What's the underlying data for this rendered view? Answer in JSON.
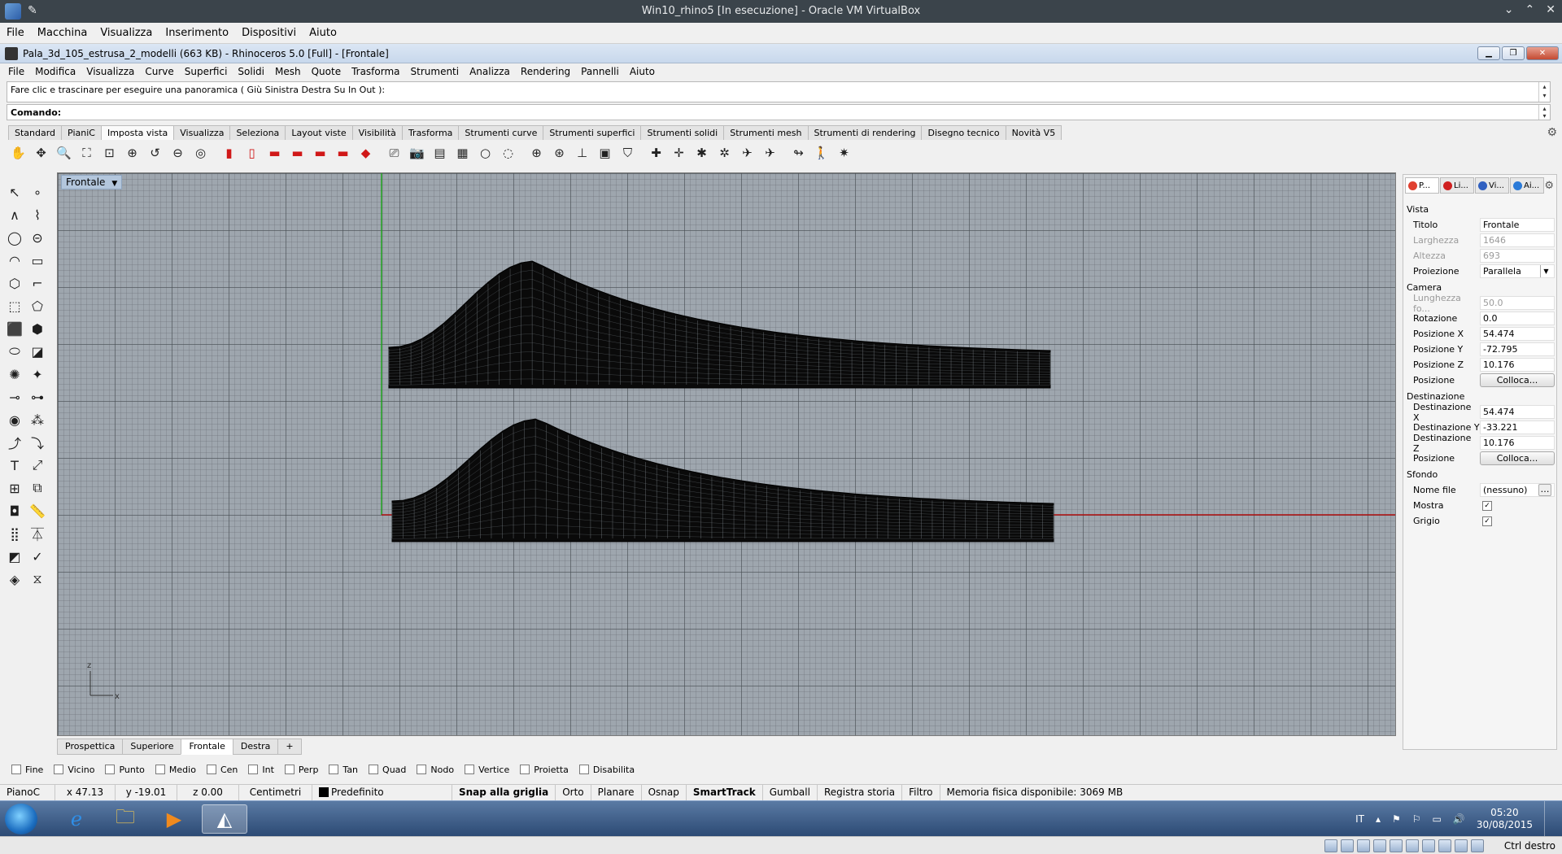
{
  "vbox": {
    "title": "Win10_rhino5 [In esecuzione] - Oracle VM VirtualBox",
    "menu": [
      "File",
      "Macchina",
      "Visualizza",
      "Inserimento",
      "Dispositivi",
      "Aiuto"
    ],
    "host_key": "Ctrl destro"
  },
  "rhino": {
    "title": "Pala_3d_105_estrusa_2_modelli (663 KB) - Rhinoceros 5.0 [Full] - [Frontale]",
    "menu": [
      "File",
      "Modifica",
      "Visualizza",
      "Curve",
      "Superfici",
      "Solidi",
      "Mesh",
      "Quote",
      "Trasforma",
      "Strumenti",
      "Analizza",
      "Rendering",
      "Pannelli",
      "Aiuto"
    ],
    "command_history": "Fare clic e trascinare per eseguire una panoramica ( Giù  Sinistra  Destra  Su  In  Out ):",
    "command_prompt": "Comando:",
    "toolbar_tabs": [
      {
        "label": "Standard",
        "active": false
      },
      {
        "label": "PianiC",
        "active": false
      },
      {
        "label": "Imposta vista",
        "active": true
      },
      {
        "label": "Visualizza",
        "active": false
      },
      {
        "label": "Seleziona",
        "active": false
      },
      {
        "label": "Layout viste",
        "active": false
      },
      {
        "label": "Visibilità",
        "active": false
      },
      {
        "label": "Trasforma",
        "active": false
      },
      {
        "label": "Strumenti curve",
        "active": false
      },
      {
        "label": "Strumenti superfici",
        "active": false
      },
      {
        "label": "Strumenti solidi",
        "active": false
      },
      {
        "label": "Strumenti mesh",
        "active": false
      },
      {
        "label": "Strumenti di rendering",
        "active": false
      },
      {
        "label": "Disegno tecnico",
        "active": false
      },
      {
        "label": "Novità V5",
        "active": false
      }
    ],
    "toolbar_icons": [
      {
        "name": "pan-hand-icon",
        "glyph": "✋",
        "red": false
      },
      {
        "name": "rotate-view-icon",
        "glyph": "✥",
        "red": false
      },
      {
        "name": "zoom-dynamic-icon",
        "glyph": "🔍",
        "red": false
      },
      {
        "name": "zoom-extents-icon",
        "glyph": "⛶",
        "red": false
      },
      {
        "name": "zoom-window-icon",
        "glyph": "⊡",
        "red": false
      },
      {
        "name": "zoom-selected-icon",
        "glyph": "⊕",
        "red": false
      },
      {
        "name": "undo-view-icon",
        "glyph": "↺",
        "red": false
      },
      {
        "name": "zoom-out-icon",
        "glyph": "⊖",
        "red": false
      },
      {
        "name": "zoom-target-icon",
        "glyph": "◎",
        "red": false
      },
      {
        "name": "sep",
        "glyph": "",
        "red": false
      },
      {
        "name": "view-top-icon",
        "glyph": "▮",
        "red": true
      },
      {
        "name": "view-bottom-icon",
        "glyph": "▯",
        "red": true
      },
      {
        "name": "view-left-icon",
        "glyph": "▬",
        "red": true
      },
      {
        "name": "view-right-icon",
        "glyph": "▬",
        "red": true
      },
      {
        "name": "view-front-icon",
        "glyph": "▬",
        "red": true
      },
      {
        "name": "view-back-icon",
        "glyph": "▬",
        "red": true
      },
      {
        "name": "view-perspective-icon",
        "glyph": "◆",
        "red": true
      },
      {
        "name": "sep",
        "glyph": "",
        "red": false
      },
      {
        "name": "set-camera-icon",
        "glyph": "⎚",
        "red": false
      },
      {
        "name": "camera-icon",
        "glyph": "📷",
        "red": false
      },
      {
        "name": "named-view-icon",
        "glyph": "▤",
        "red": false
      },
      {
        "name": "save-view-icon",
        "glyph": "▦",
        "red": false
      },
      {
        "name": "light-icon",
        "glyph": "○",
        "red": false
      },
      {
        "name": "spotlight-icon",
        "glyph": "◌",
        "red": false
      },
      {
        "name": "sep",
        "glyph": "",
        "red": false
      },
      {
        "name": "target-icon",
        "glyph": "⊕",
        "red": false
      },
      {
        "name": "camera-target-icon",
        "glyph": "⊛",
        "red": false
      },
      {
        "name": "set-cplane-icon",
        "glyph": "⊥",
        "red": false
      },
      {
        "name": "plan-view-icon",
        "glyph": "▣",
        "red": false
      },
      {
        "name": "shield-view-icon",
        "glyph": "⛉",
        "red": false
      },
      {
        "name": "sep",
        "glyph": "",
        "red": false
      },
      {
        "name": "cplane-origin-icon",
        "glyph": "✚",
        "red": false
      },
      {
        "name": "cplane-elevation-icon",
        "glyph": "✛",
        "red": false
      },
      {
        "name": "cplane-rotate-icon",
        "glyph": "✱",
        "red": false
      },
      {
        "name": "cplane-3pt-icon",
        "glyph": "✲",
        "red": false
      },
      {
        "name": "cplane-object-icon",
        "glyph": "✈",
        "red": false
      },
      {
        "name": "cplane-view-icon",
        "glyph": "✈",
        "red": false
      },
      {
        "name": "sep",
        "glyph": "",
        "red": false
      },
      {
        "name": "flip-view-icon",
        "glyph": "↬",
        "red": false
      },
      {
        "name": "walkabout-icon",
        "glyph": "🚶",
        "red": false
      },
      {
        "name": "sun-icon",
        "glyph": "✷",
        "red": false
      }
    ],
    "left_tools": [
      {
        "name": "select-arrow-icon",
        "glyph": "↖"
      },
      {
        "name": "point-icon",
        "glyph": "∘"
      },
      {
        "name": "polyline-icon",
        "glyph": "∧"
      },
      {
        "name": "curve-control-points-icon",
        "glyph": "⌇"
      },
      {
        "name": "circle-icon",
        "glyph": "◯"
      },
      {
        "name": "ellipse-icon",
        "glyph": "⊝"
      },
      {
        "name": "arc-icon",
        "glyph": "◠"
      },
      {
        "name": "rectangle-icon",
        "glyph": "▭"
      },
      {
        "name": "polygon-icon",
        "glyph": "⬡"
      },
      {
        "name": "fillet-curve-icon",
        "glyph": "⌐"
      },
      {
        "name": "surface-from-points-icon",
        "glyph": "⬚"
      },
      {
        "name": "loft-icon",
        "glyph": "⬠"
      },
      {
        "name": "box-icon",
        "glyph": "⬛"
      },
      {
        "name": "boolean-union-icon",
        "glyph": "⬢"
      },
      {
        "name": "extrude-icon",
        "glyph": "⬭"
      },
      {
        "name": "surface-edit-icon",
        "glyph": "◪"
      },
      {
        "name": "mesh-icon",
        "glyph": "✺"
      },
      {
        "name": "explode-icon",
        "glyph": "✦"
      },
      {
        "name": "trim-icon",
        "glyph": "⊸"
      },
      {
        "name": "split-icon",
        "glyph": "⊶"
      },
      {
        "name": "group-icon",
        "glyph": "◉"
      },
      {
        "name": "ungroup-icon",
        "glyph": "⁂"
      },
      {
        "name": "rebuild-icon",
        "glyph": "⤴"
      },
      {
        "name": "edit-points-icon",
        "glyph": "⤵"
      },
      {
        "name": "text-icon",
        "glyph": "T"
      },
      {
        "name": "dimension-icon",
        "glyph": "⤢"
      },
      {
        "name": "array-icon",
        "glyph": "⊞"
      },
      {
        "name": "mirror-icon",
        "glyph": "⧉"
      },
      {
        "name": "solid-tools-icon",
        "glyph": "◘"
      },
      {
        "name": "measure-icon",
        "glyph": "📏"
      },
      {
        "name": "grid-array-icon",
        "glyph": "⣿"
      },
      {
        "name": "pipeline-icon",
        "glyph": "⏄"
      },
      {
        "name": "analyze-icon",
        "glyph": "◩"
      },
      {
        "name": "check-icon",
        "glyph": "✓"
      },
      {
        "name": "render-icon",
        "glyph": "◈"
      },
      {
        "name": "render-settings-icon",
        "glyph": "⧖"
      }
    ],
    "viewport": {
      "title": "Frontale",
      "axis_z": "z",
      "axis_x": "x"
    },
    "viewport_tabs": [
      {
        "label": "Prospettica",
        "active": false
      },
      {
        "label": "Superiore",
        "active": false
      },
      {
        "label": "Frontale",
        "active": true
      },
      {
        "label": "Destra",
        "active": false
      },
      {
        "label": "+",
        "active": false
      }
    ],
    "properties": {
      "tabs": [
        "P...",
        "Li...",
        "Vi...",
        "Ai..."
      ],
      "vista_title": "Vista",
      "rows_vista": [
        {
          "key": "Titolo",
          "value": "Frontale",
          "kind": "text",
          "disabled": false
        },
        {
          "key": "Larghezza",
          "value": "1646",
          "kind": "text",
          "disabled": true
        },
        {
          "key": "Altezza",
          "value": "693",
          "kind": "text",
          "disabled": true
        },
        {
          "key": "Proiezione",
          "value": "Parallela",
          "kind": "combo",
          "disabled": false
        }
      ],
      "camera_title": "Camera",
      "rows_camera": [
        {
          "key": "Lunghezza fo...",
          "value": "50.0",
          "kind": "text",
          "disabled": true
        },
        {
          "key": "Rotazione",
          "value": "0.0",
          "kind": "text",
          "disabled": false
        },
        {
          "key": "Posizione X",
          "value": "54.474",
          "kind": "text",
          "disabled": false
        },
        {
          "key": "Posizione Y",
          "value": "-72.795",
          "kind": "text",
          "disabled": false
        },
        {
          "key": "Posizione Z",
          "value": "10.176",
          "kind": "text",
          "disabled": false
        },
        {
          "key": "Posizione",
          "value": "Colloca...",
          "kind": "button",
          "disabled": false
        }
      ],
      "dest_title": "Destinazione",
      "rows_dest": [
        {
          "key": "Destinazione X",
          "value": "54.474",
          "kind": "text",
          "disabled": false
        },
        {
          "key": "Destinazione Y",
          "value": "-33.221",
          "kind": "text",
          "disabled": false
        },
        {
          "key": "Destinazione Z",
          "value": "10.176",
          "kind": "text",
          "disabled": false
        },
        {
          "key": "Posizione",
          "value": "Colloca...",
          "kind": "button",
          "disabled": false
        }
      ],
      "sfondo_title": "Sfondo",
      "rows_sfondo": [
        {
          "key": "Nome file",
          "value": "(nessuno)",
          "kind": "file",
          "disabled": false
        },
        {
          "key": "Mostra",
          "value": "✓",
          "kind": "check",
          "disabled": false
        },
        {
          "key": "Grigio",
          "value": "✓",
          "kind": "check",
          "disabled": false
        }
      ]
    },
    "osnaps": [
      {
        "label": "Fine",
        "checked": false
      },
      {
        "label": "Vicino",
        "checked": false
      },
      {
        "label": "Punto",
        "checked": false
      },
      {
        "label": "Medio",
        "checked": false
      },
      {
        "label": "Cen",
        "checked": false
      },
      {
        "label": "Int",
        "checked": false
      },
      {
        "label": "Perp",
        "checked": false
      },
      {
        "label": "Tan",
        "checked": false
      },
      {
        "label": "Quad",
        "checked": false
      },
      {
        "label": "Nodo",
        "checked": false
      },
      {
        "label": "Vertice",
        "checked": false
      },
      {
        "label": "Proietta",
        "checked": false
      },
      {
        "label": "Disabilita",
        "checked": false
      }
    ],
    "status": {
      "cplane": "PianoC",
      "x": "x 47.13",
      "y": "y -19.01",
      "z": "z 0.00",
      "units": "Centimetri",
      "layer": "Predefinito",
      "toggles": [
        {
          "label": "Snap alla griglia",
          "bold": true
        },
        {
          "label": "Orto",
          "bold": false
        },
        {
          "label": "Planare",
          "bold": false
        },
        {
          "label": "Osnap",
          "bold": false
        },
        {
          "label": "SmartTrack",
          "bold": true
        },
        {
          "label": "Gumball",
          "bold": false
        },
        {
          "label": "Registra storia",
          "bold": false
        },
        {
          "label": "Filtro",
          "bold": false
        }
      ],
      "memory": "Memoria fisica disponibile: 3069 MB"
    }
  },
  "taskbar": {
    "lang": "IT",
    "time": "05:20",
    "date": "30/08/2015"
  }
}
